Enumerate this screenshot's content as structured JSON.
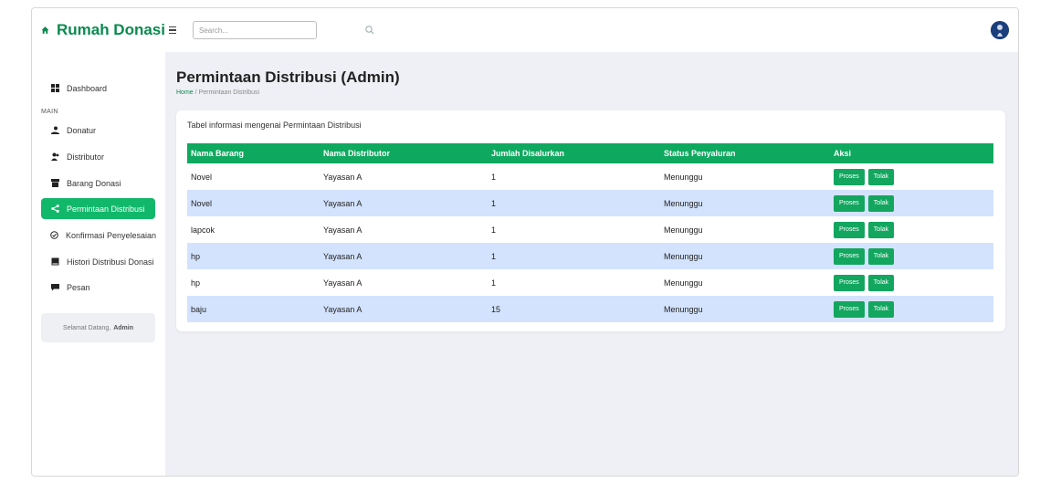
{
  "brand": {
    "name": "Rumah Donasi",
    "color": "#0b8a4f"
  },
  "search": {
    "placeholder": "Search..."
  },
  "sidebar": {
    "dashboard": "Dashboard",
    "section_heading": "MAIN",
    "items": [
      {
        "label": "Donatur",
        "icon": "donor-icon"
      },
      {
        "label": "Distributor",
        "icon": "users-icon"
      },
      {
        "label": "Barang Donasi",
        "icon": "box-icon"
      },
      {
        "label": "Permintaan Distribusi",
        "icon": "share-icon",
        "active": true
      },
      {
        "label": "Konfirmasi Penyelesaian",
        "icon": "check-circle-icon"
      },
      {
        "label": "Histori Distribusi Donasi",
        "icon": "archive-icon"
      },
      {
        "label": "Pesan",
        "icon": "message-icon"
      }
    ],
    "welcome_prefix": "Selamat Datang,",
    "welcome_user": "Admin"
  },
  "main": {
    "title": "Permintaan Distribusi (Admin)",
    "breadcrumb_home": "Home",
    "breadcrumb_sep": "/",
    "breadcrumb_current": "Permintaan Distribusi",
    "card_title": "Tabel informasi mengenai Permintaan Distribusi",
    "table": {
      "headers": [
        "Nama Barang",
        "Nama Distributor",
        "Jumlah Disalurkan",
        "Status Penyaluran",
        "Aksi"
      ],
      "rows": [
        [
          "Novel",
          "Yayasan A",
          "1",
          "Menunggu"
        ],
        [
          "Novel",
          "Yayasan A",
          "1",
          "Menunggu"
        ],
        [
          "lapcok",
          "Yayasan A",
          "1",
          "Menunggu"
        ],
        [
          "hp",
          "Yayasan A",
          "1",
          "Menunggu"
        ],
        [
          "hp",
          "Yayasan A",
          "1",
          "Menunggu"
        ],
        [
          "baju",
          "Yayasan A",
          "15",
          "Menunggu"
        ]
      ],
      "action_process": "Proses",
      "action_reject": "Tolak"
    }
  },
  "colors": {
    "accent": "#12b86a",
    "header": "#0fa85f",
    "row_alt": "#d3e3fd",
    "background": "#eff0f5"
  }
}
